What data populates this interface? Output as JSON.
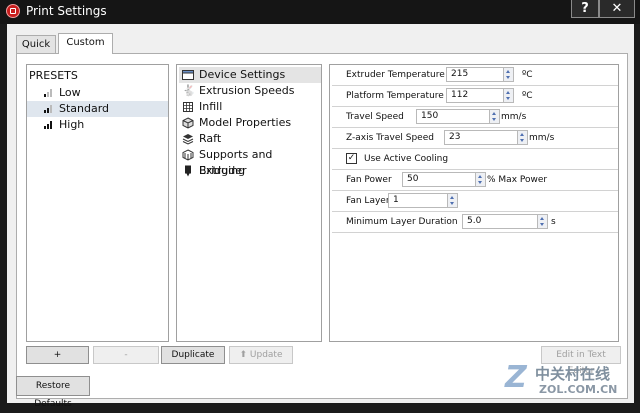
{
  "window": {
    "title": "Print Settings",
    "help_label": "?",
    "close_label": "✕"
  },
  "tabs": [
    {
      "label": "Quick"
    },
    {
      "label": "Custom"
    }
  ],
  "presets": {
    "heading": "PRESETS",
    "items": [
      {
        "label": "Low",
        "icon": "signal-low-icon"
      },
      {
        "label": "Standard",
        "icon": "signal-medium-icon",
        "selected": true
      },
      {
        "label": "High",
        "icon": "signal-high-icon"
      }
    ]
  },
  "categories": [
    {
      "label": "Device Settings",
      "icon": "window-icon",
      "selected": true
    },
    {
      "label": "Extrusion Speeds",
      "icon": "rabbit-icon"
    },
    {
      "label": "Infill",
      "icon": "infill-cube-icon"
    },
    {
      "label": "Model Properties",
      "icon": "model-cube-icon"
    },
    {
      "label": "Raft",
      "icon": "raft-layers-icon"
    },
    {
      "label": "Supports and Bridging",
      "icon": "supports-icon"
    },
    {
      "label": "Extruder",
      "icon": "extruder-icon"
    }
  ],
  "settings": {
    "extruder_temperature": {
      "label": "Extruder Temperature",
      "value": "215",
      "unit": "ºC"
    },
    "platform_temperature": {
      "label": "Platform Temperature",
      "value": "112",
      "unit": "ºC"
    },
    "travel_speed": {
      "label": "Travel Speed",
      "value": "150",
      "unit": "mm/s"
    },
    "z_travel_speed": {
      "label": "Z-axis Travel Speed",
      "value": "23",
      "unit": "mm/s"
    },
    "active_cooling": {
      "label": "Use Active Cooling",
      "checked": true
    },
    "fan_power": {
      "label": "Fan Power",
      "value": "50",
      "unit": "% Max Power"
    },
    "fan_layer": {
      "label": "Fan Layer",
      "value": "1"
    },
    "min_layer_duration": {
      "label": "Minimum Layer Duration",
      "value": "5.0",
      "unit": "s"
    }
  },
  "buttons": {
    "add": "+",
    "remove": "-",
    "duplicate": "Duplicate",
    "update": "Update",
    "edit_text": "Edit in Text Editor",
    "restore": "Restore Defaults"
  },
  "watermark": {
    "cn": "中关村在线",
    "en": "ZOL.COM.CN"
  }
}
